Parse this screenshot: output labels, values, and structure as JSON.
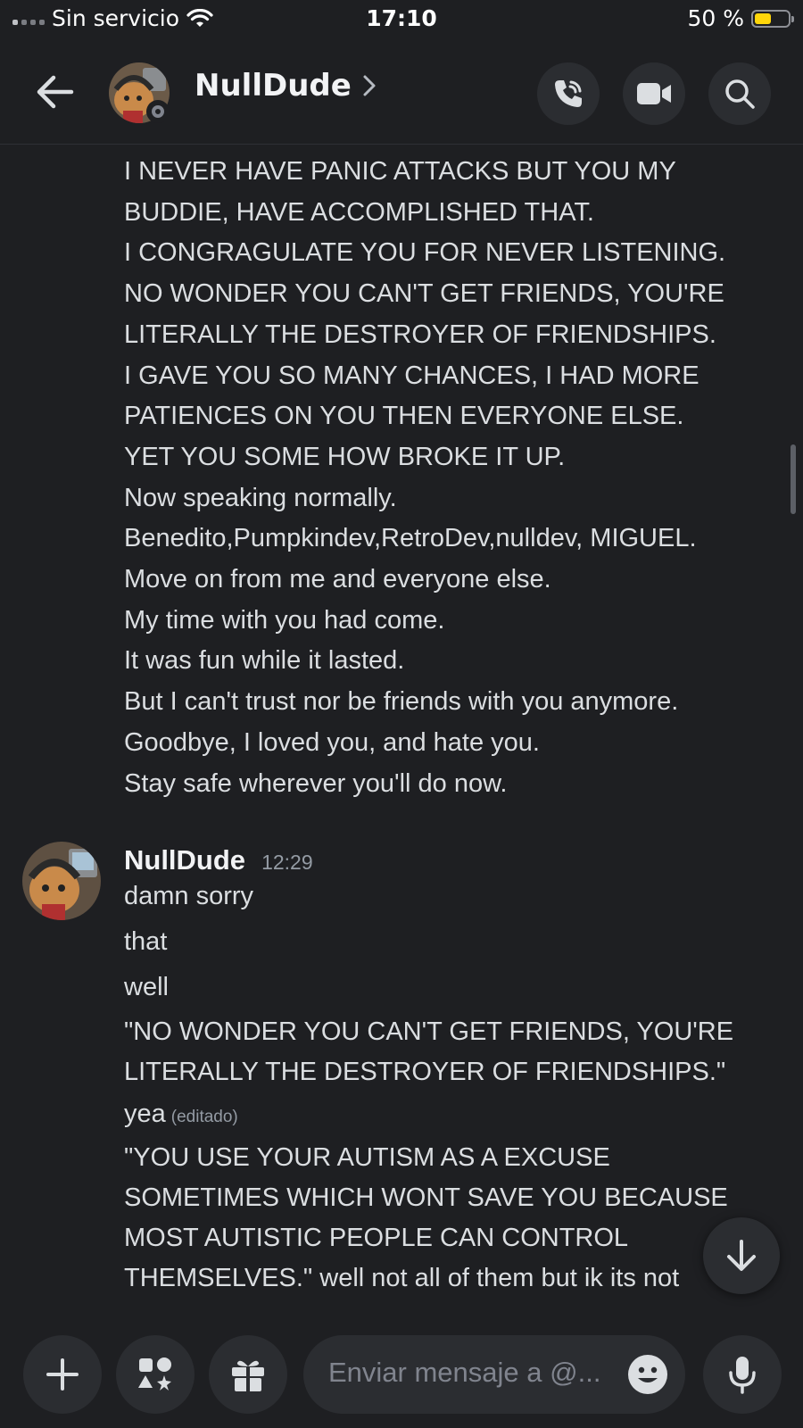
{
  "status_bar": {
    "carrier": "Sin servicio",
    "time": "17:10",
    "battery": "50 %",
    "battery_level": 0.5
  },
  "header": {
    "name": "NullDude"
  },
  "messages": {
    "continued_lines": [
      "I NEVER HAVE PANIC ATTACKS BUT YOU MY",
      "BUDDIE, HAVE ACCOMPLISHED THAT.",
      "I CONGRAGULATE YOU FOR NEVER LISTENING.",
      "NO WONDER YOU CAN'T GET FRIENDS, YOU'RE",
      "LITERALLY THE DESTROYER OF FRIENDSHIPS.",
      "I GAVE YOU SO MANY CHANCES, I HAD MORE",
      "PATIENCES ON YOU THEN EVERYONE ELSE.",
      "YET YOU SOME HOW BROKE IT UP.",
      "Now speaking normally.",
      "Benedito,Pumpkindev,RetroDev,nulldev, MIGUEL.",
      "Move on from me and everyone else.",
      "My time with you had come.",
      "It was fun while it lasted.",
      "But I can't trust nor be friends with you anymore.",
      "Goodbye, I loved you, and hate you.",
      "Stay safe wherever you'll do now."
    ],
    "group": {
      "author": "NullDude",
      "time": "12:29",
      "lines": [
        "damn sorry",
        "that",
        "well",
        "\"NO WONDER YOU CAN'T GET FRIENDS, YOU'RE",
        "LITERALLY THE DESTROYER OF FRIENDSHIPS.\"",
        "yea",
        "\"YOU USE YOUR AUTISM AS A EXCUSE",
        "SOMETIMES WHICH WONT SAVE YOU BECAUSE",
        "MOST AUTISTIC PEOPLE CAN CONTROL",
        "THEMSELVES.\" well not all of them but ik its not"
      ],
      "edited_label": "(editado)"
    }
  },
  "composer": {
    "placeholder": "Enviar mensaje a @..."
  },
  "colors": {
    "background": "#1e1f22",
    "button_bg": "#2b2d31",
    "text": "#dbdee1",
    "muted": "#949ba4",
    "battery_fill": "#ffd60a"
  },
  "icons": [
    "signal-icon",
    "wifi-icon",
    "battery-icon",
    "back-arrow-icon",
    "chevron-right-icon",
    "voice-call-icon",
    "video-call-icon",
    "search-icon",
    "jump-down-arrow-icon",
    "plus-icon",
    "apps-icon",
    "gift-icon",
    "emoji-icon",
    "microphone-icon"
  ]
}
